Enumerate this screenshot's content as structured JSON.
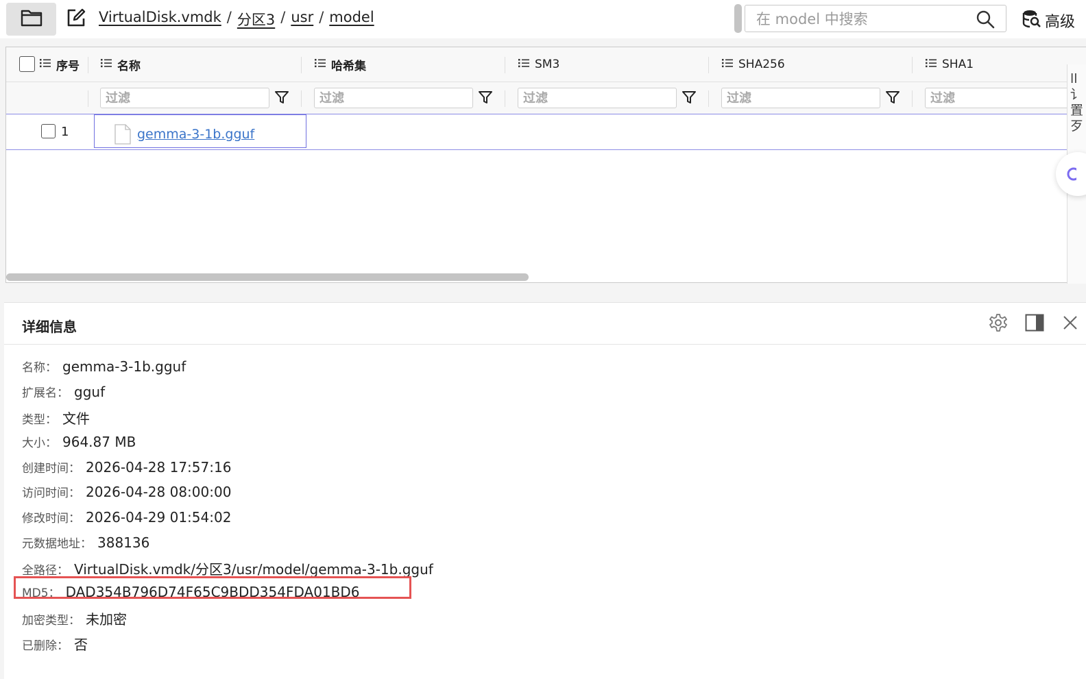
{
  "toolbar": {
    "folder_icon": "folder-icon",
    "edit_icon": "edit-icon",
    "breadcrumb": [
      "VirtualDisk.vmdk",
      "分区3",
      "usr",
      "model"
    ],
    "separator": "/",
    "search_placeholder": "在 model 中搜索",
    "advanced_label": "高级"
  },
  "table": {
    "columns": [
      {
        "key": "index",
        "label": "序号"
      },
      {
        "key": "name",
        "label": "名称"
      },
      {
        "key": "hashset",
        "label": "哈希集"
      },
      {
        "key": "sm3",
        "label": "SM3"
      },
      {
        "key": "sha256",
        "label": "SHA256"
      },
      {
        "key": "sha1",
        "label": "SHA1"
      }
    ],
    "filter_placeholder": "过滤",
    "rows": [
      {
        "index": "1",
        "name": "gemma-3-1b.gguf",
        "hashset": "",
        "sm3": "",
        "sha256": "",
        "sha1": ""
      }
    ]
  },
  "edge": {
    "chars": "ll\n讠\n置\n歹"
  },
  "details": {
    "title": "详细信息",
    "properties": [
      {
        "label": "名称：",
        "value": "gemma-3-1b.gguf"
      },
      {
        "label": "扩展名：",
        "value": "gguf"
      },
      {
        "label": "类型：",
        "value": "文件"
      },
      {
        "label": "大小：",
        "value": "964.87 MB"
      },
      {
        "label": "创建时间：",
        "value": "2026-04-28 17:57:16"
      },
      {
        "label": "访问时间：",
        "value": "2026-04-28 08:00:00"
      },
      {
        "label": "修改时间：",
        "value": "2026-04-29 01:54:02"
      },
      {
        "label": "元数据地址：",
        "value": "388136"
      },
      {
        "label": "全路径：",
        "value": "VirtualDisk.vmdk/分区3/usr/model/gemma-3-1b.gguf"
      },
      {
        "label": "MD5：",
        "value": "DAD354B796D74F65C9BDD354FDA01BD6"
      },
      {
        "label": "加密类型：",
        "value": "未加密"
      },
      {
        "label": "已删除：",
        "value": "否"
      }
    ]
  },
  "colors": {
    "accent_border": "#6f6fe0",
    "link": "#3a74c9",
    "highlight": "#e55353"
  }
}
